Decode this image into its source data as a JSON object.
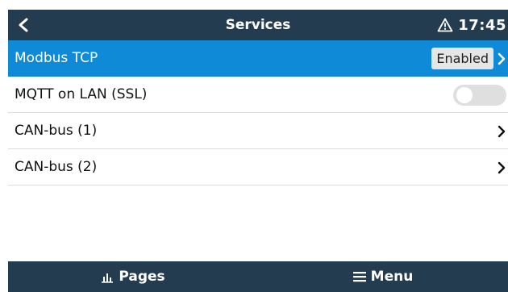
{
  "header": {
    "title": "Services",
    "time": "17:45",
    "back_icon": "chevron-left-icon",
    "alarm_icon": "warning-triangle-icon"
  },
  "list": {
    "items": [
      {
        "label": "Modbus TCP",
        "value": "Enabled",
        "selected": true
      },
      {
        "label": "MQTT on LAN (SSL)",
        "toggle_on": false
      },
      {
        "label": "CAN-bus (1)"
      },
      {
        "label": "CAN-bus (2)"
      }
    ]
  },
  "footer": {
    "pages_label": "Pages",
    "pages_icon": "bar-chart-icon",
    "menu_label": "Menu",
    "menu_icon": "hamburger-menu-icon"
  },
  "colors": {
    "header_bg": "#243c4f",
    "selected_bg": "#0f8ad6"
  }
}
